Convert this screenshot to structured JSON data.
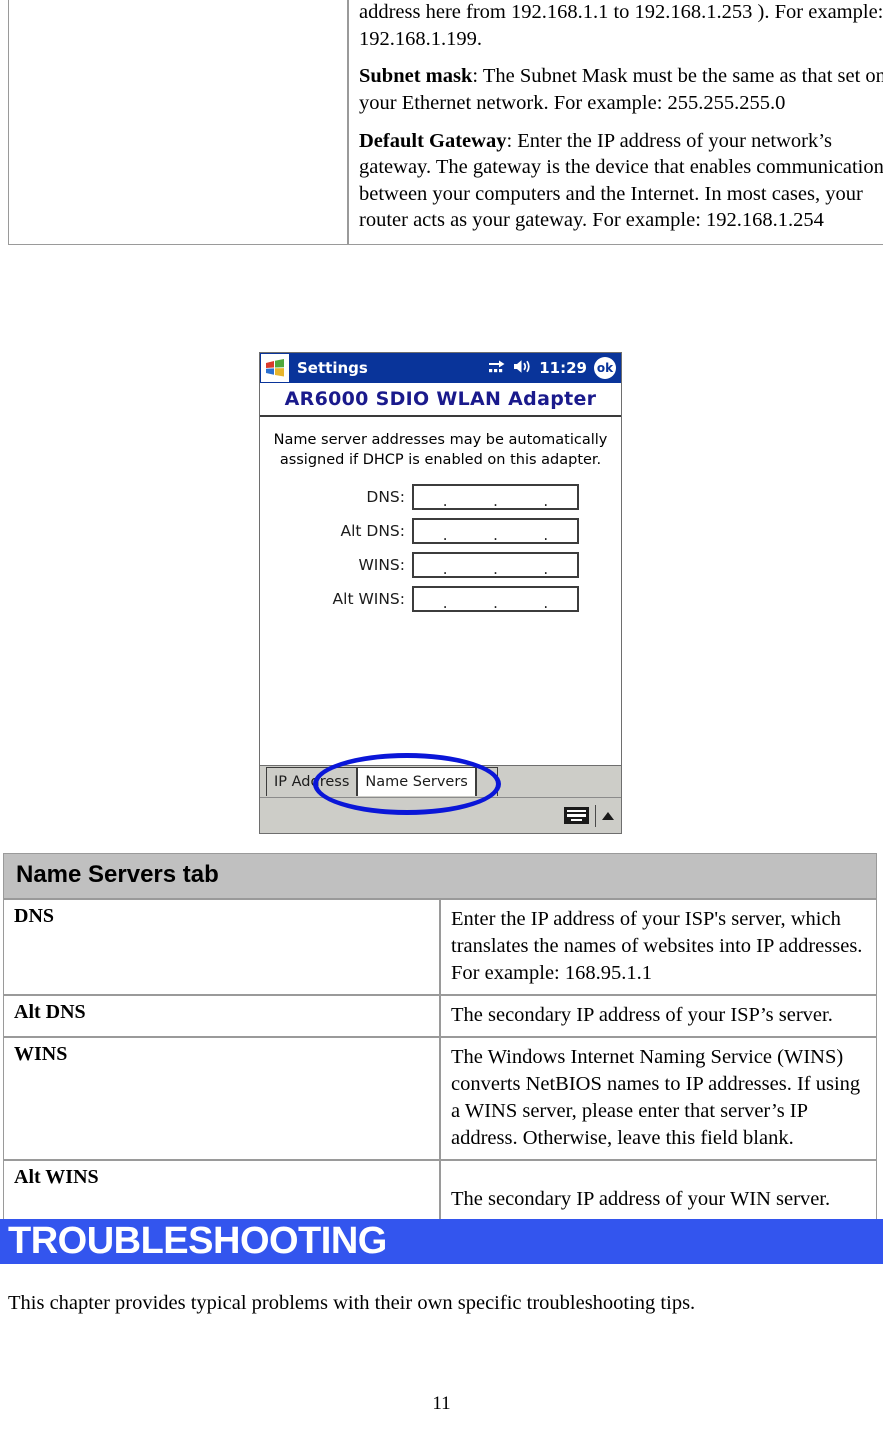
{
  "top_table": {
    "left_cell": "",
    "paragraphs": [
      {
        "lead": "",
        "text": "address here from 192.168.1.1 to 192.168.1.253 ). For example: 192.168.1.199."
      },
      {
        "lead": "Subnet mask",
        "text": ": The Subnet Mask must be the same as that set on your Ethernet network. For example: 255.255.255.0"
      },
      {
        "lead": "Default Gateway",
        "text": ": Enter the IP address of your network’s gateway. The gateway is the device that enables communication between your computers and the Internet. In most cases, your router acts as your gateway. For example: 192.168.1.254"
      }
    ]
  },
  "pda": {
    "titlebar": {
      "start_icon": "windows-flag-icon",
      "title": "Settings",
      "connectivity_icon": "network-connectivity-icon",
      "volume_icon": "speaker-icon",
      "clock": "11:29",
      "ok_label": "ok"
    },
    "adapter_title": "AR6000 SDIO WLAN Adapter",
    "hint": "Name server addresses may be automatically assigned if DHCP is enabled on this adapter.",
    "fields": [
      {
        "label": "DNS:",
        "value": "",
        "placeholder": ". . ."
      },
      {
        "label": "Alt DNS:",
        "value": "",
        "placeholder": ". . ."
      },
      {
        "label": "WINS:",
        "value": "",
        "placeholder": ". . ."
      },
      {
        "label": "Alt WINS:",
        "value": "",
        "placeholder": ". . ."
      }
    ],
    "tabs": [
      {
        "label": "IP Address",
        "active": false
      },
      {
        "label": "Name Servers",
        "active": true
      }
    ],
    "sip": {
      "keyboard_icon": "keyboard-icon",
      "arrow_icon": "caret-up-icon"
    },
    "annotation": {
      "shape": "ellipse",
      "color": "#0a16d8",
      "targets": "Name Servers tab"
    }
  },
  "ns_table": {
    "header": "Name Servers tab",
    "rows": [
      {
        "key": "DNS",
        "value": "Enter the IP address of your ISP's server, which translates the names of websites into IP addresses. For example: 168.95.1.1"
      },
      {
        "key": "Alt DNS",
        "value": "The secondary IP address of your ISP’s server."
      },
      {
        "key": "WINS",
        "value": "The Windows Internet Naming Service (WINS) converts NetBIOS names to IP addresses. If using a WINS server, please enter that server’s IP address. Otherwise, leave this field blank."
      },
      {
        "key": "Alt WINS",
        "value": "The secondary IP address of your WIN server."
      }
    ]
  },
  "banner": {
    "title": "TROUBLESHOOTING",
    "color": "#3355ee"
  },
  "closing_paragraph": "This chapter provides typical problems with their own specific troubleshooting tips.",
  "page_number": "11"
}
